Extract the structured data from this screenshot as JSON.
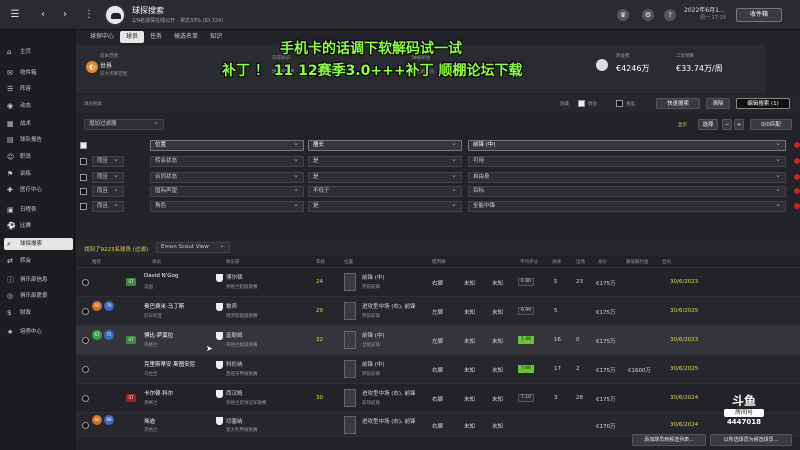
{
  "topbar": {
    "title": "球探搜索",
    "subtitle": "2/9名球探在线公开 - 常达33% (ID:724)",
    "date": "2022年6月1...",
    "time": "周一 17:15",
    "inbox_label": "收件箱"
  },
  "sidebar": {
    "items": [
      {
        "label": "主页",
        "icon": "⌂"
      },
      {
        "label": "收件箱",
        "icon": "✉"
      },
      {
        "label": "阵容",
        "icon": "☰"
      },
      {
        "label": "动态",
        "icon": "◉"
      },
      {
        "label": "战术",
        "icon": "▦"
      },
      {
        "label": "球队报告",
        "icon": "▤"
      },
      {
        "label": "职员",
        "icon": "☺"
      },
      {
        "label": "训练",
        "icon": "⚑"
      },
      {
        "label": "医疗中心",
        "icon": "✚"
      },
      {
        "label": "日程表",
        "icon": "▣"
      },
      {
        "label": "比赛",
        "icon": "⚽"
      },
      {
        "label": "球探搜索",
        "icon": "⌕"
      },
      {
        "label": "转会",
        "icon": "⇄"
      },
      {
        "label": "俱乐部信息",
        "icon": "ⓘ"
      },
      {
        "label": "俱乐部愿景",
        "icon": "◎"
      },
      {
        "label": "财政",
        "icon": "$"
      },
      {
        "label": "培养中心",
        "icon": "★"
      }
    ]
  },
  "tabs": [
    "球探中心",
    "球员",
    "任务",
    "候选名单",
    "知识"
  ],
  "scout_info": {
    "label1": "成本范围",
    "region": "世界",
    "region_sub": "较大考察范围",
    "label2": "日常知识",
    "text2": "球员知识库",
    "label3": "球探评估",
    "text3": "所有的球员"
  },
  "finance": {
    "budget_label": "转会费",
    "budget": "€4246万",
    "wage_label": "工资预算",
    "wage": "€33.74万/周"
  },
  "overlay": {
    "line1": "手机卡的话调下软解码试一试",
    "line2": "补丁 ！ 11 12赛季3.0+++补丁 顺棚论坛下载"
  },
  "filter": {
    "section_label": "球员搜索",
    "add_filter": "增加过滤器",
    "hide_label": "隐藏",
    "transfer_label": "转会",
    "similar_label": "相差",
    "quick_search": "快速搜索",
    "clear": "清除",
    "edit_search": "编辑搜索 (1)",
    "choose": "选择",
    "match": "0/0匹配",
    "show": "显示",
    "rows": [
      {
        "logic": "",
        "field": "位置",
        "op": "擅长",
        "value": "前锋 (中)"
      },
      {
        "logic": "而且",
        "field": "转会状态",
        "op": "是",
        "value": "可用"
      },
      {
        "logic": "而且",
        "field": "合同状态",
        "op": "是",
        "value": "自由身"
      },
      {
        "logic": "而且",
        "field": "国际声望",
        "op": "不低于",
        "value": "目标"
      },
      {
        "logic": "而且",
        "field": "角色",
        "op": "是",
        "value": "全能中锋"
      }
    ]
  },
  "results": {
    "found": "找到了9223名球员 (过滤)",
    "view": "Emon Scout View"
  },
  "columns": [
    "推荐",
    "",
    "",
    "球员",
    "",
    "",
    "俱乐部",
    "年龄",
    "位置",
    "",
    "惯用脚",
    "",
    "",
    "平均评分",
    "进球",
    "出场",
    "身价",
    "最低解约金",
    "合同"
  ],
  "players": [
    {
      "name": "David N'Gog",
      "nation": "法国",
      "club": "博尔顿",
      "league": "英格兰超级联赛",
      "age": "24",
      "pos": "前锋 (中)",
      "pos2": "突前前锋",
      "foot": "右脚",
      "rating": "6.86",
      "goals": "5",
      "apps": "23",
      "value": "€175万",
      "release": "",
      "contract": "30/6/2023",
      "badge": "",
      "rating_good": false
    },
    {
      "name": "奥巴费米·马丁斯",
      "nation": "尼日利亚",
      "club": "鲁宾",
      "league": "俄罗斯超级联赛",
      "age": "29",
      "pos": "进攻型中场 (右), 前锋",
      "pos2": "突前前锋",
      "foot": "左脚",
      "rating": "6.99",
      "goals": "5",
      "apps": "",
      "value": "€175万",
      "release": "",
      "contract": "30/6/2025",
      "badge": "",
      "rating_good": false
    },
    {
      "name": "博比·萨莫拉",
      "nation": "英格兰",
      "club": "富勒姆",
      "league": "英格兰超级联赛",
      "age": "32",
      "pos": "前锋 (中)",
      "pos2": "全能前锋",
      "foot": "左脚",
      "rating": "7.46",
      "goals": "16",
      "apps": "0",
      "value": "€175万",
      "release": "",
      "contract": "30/6/2023",
      "badge": "",
      "rating_good": true
    },
    {
      "name": "克里斯蒂安·斯图安尼",
      "nation": "乌拉圭",
      "club": "科伦纳",
      "league": "西班牙甲级联赛",
      "age": "",
      "pos": "前锋 (中)",
      "pos2": "突前前锋",
      "foot": "右脚",
      "rating": "7.66",
      "goals": "17",
      "apps": "2",
      "value": "€175万",
      "release": "€1600万",
      "contract": "30/6/2025",
      "badge": "",
      "rating_good": true
    },
    {
      "name": "卡尔顿·科尔",
      "nation": "英格兰",
      "club": "西汉姆",
      "league": "英格兰足球冠军联赛",
      "age": "30",
      "pos": "进攻型中场 (右), 前锋",
      "pos2": "前场前锋",
      "foot": "右脚",
      "rating": "7.10",
      "goals": "3",
      "apps": "28",
      "value": "€175万",
      "release": "",
      "contract": "30/6/2024",
      "badge": "",
      "rating_good": false
    },
    {
      "name": "埃迪",
      "nation": "英格兰",
      "club": "切塞纳",
      "league": "意大利甲级联赛",
      "age": "",
      "pos": "进攻型中场 (右), 前锋",
      "pos2": "",
      "foot": "右脚",
      "rating": "",
      "goals": "",
      "apps": "",
      "value": "€170万",
      "release": "",
      "contract": "30/6/2024",
      "badge": "",
      "rating_good": false
    }
  ],
  "bottom": {
    "add_shortlist": "添加球员到候选列表...",
    "cancel_all": "以所选球员为候选球员..."
  },
  "douyu": {
    "brand": "斗鱼",
    "sub": "房间号",
    "room": "4447018"
  },
  "unknown_label": "未知"
}
